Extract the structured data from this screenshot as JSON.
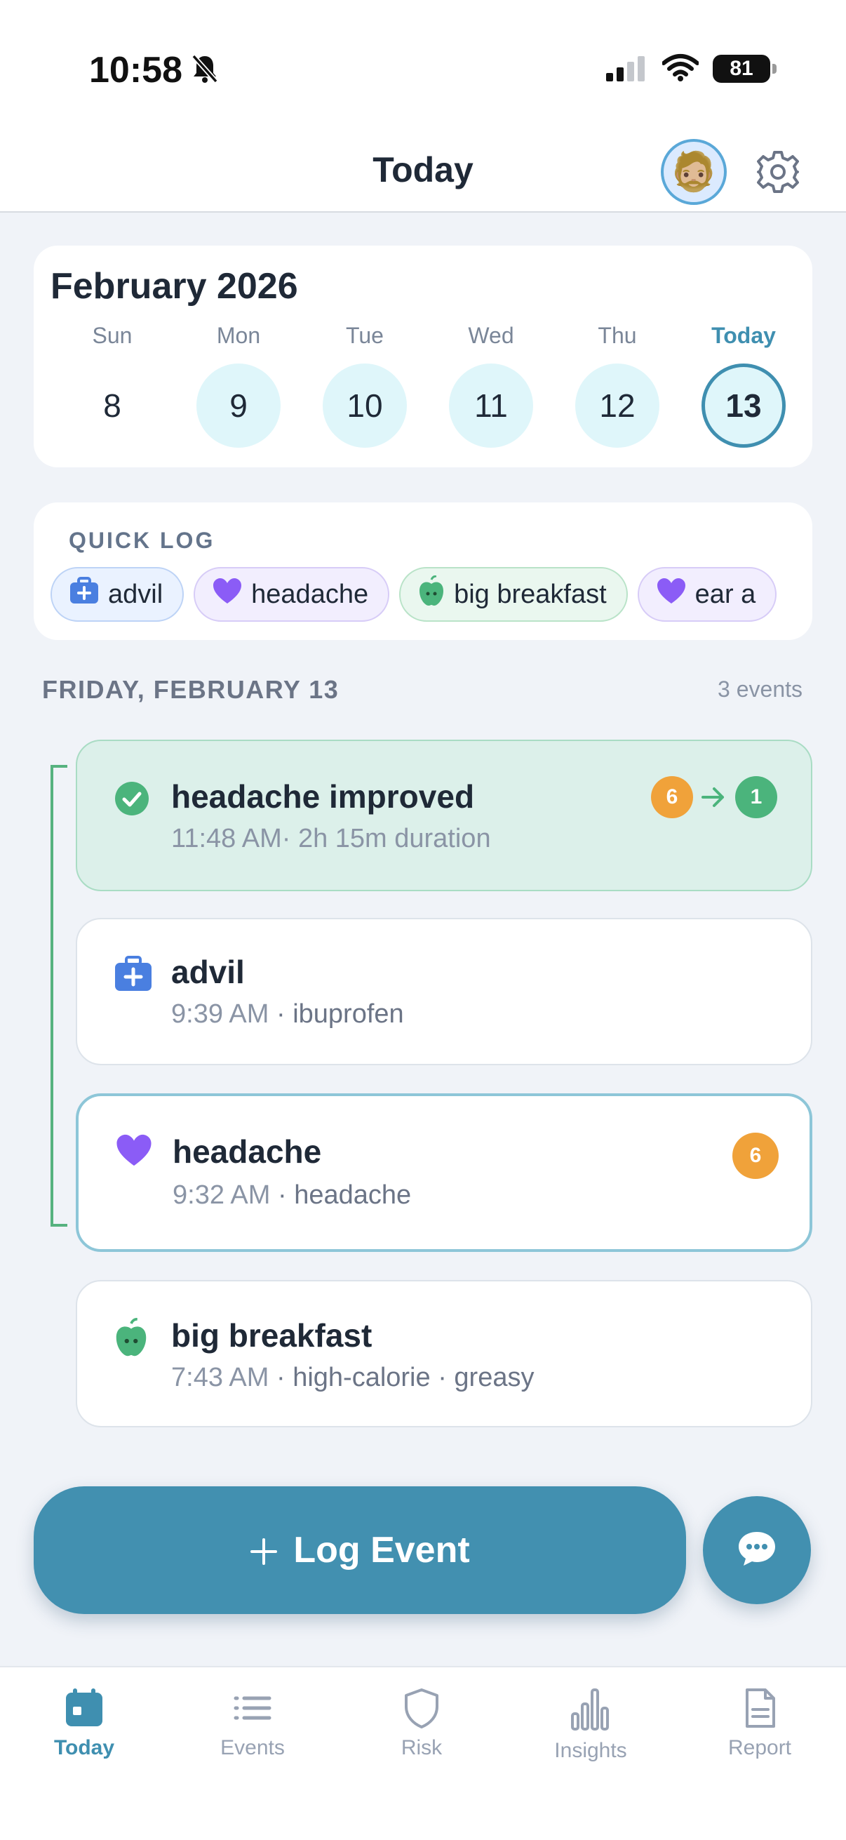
{
  "status_bar": {
    "time": "10:58",
    "battery": "81"
  },
  "header": {
    "title": "Today",
    "avatar": "🧔🏼"
  },
  "calendar": {
    "month": "February 2026",
    "days": [
      {
        "name": "Sun",
        "num": "8"
      },
      {
        "name": "Mon",
        "num": "9"
      },
      {
        "name": "Tue",
        "num": "10"
      },
      {
        "name": "Wed",
        "num": "11"
      },
      {
        "name": "Thu",
        "num": "12"
      },
      {
        "name": "Today",
        "num": "13"
      }
    ]
  },
  "quick_log": {
    "label": "QUICK LOG",
    "chips": [
      {
        "label": "advil",
        "icon": "medicine-kit-icon"
      },
      {
        "label": "headache",
        "icon": "heart-icon"
      },
      {
        "label": "big breakfast",
        "icon": "apple-icon"
      },
      {
        "label": "ear a",
        "icon": "heart-icon"
      }
    ]
  },
  "day": {
    "title": "FRIDAY, FEBRUARY 13",
    "count": "3 events"
  },
  "events": [
    {
      "title": "headache improved",
      "sub": "11:48 AM· 2h 15m duration",
      "from": "6",
      "to": "1"
    },
    {
      "title": "advil",
      "time": "9:39 AM",
      "detail": " · ibuprofen"
    },
    {
      "title": "headache",
      "time": "9:32 AM",
      "detail": " · headache",
      "severity": "6"
    },
    {
      "title": "big breakfast",
      "time": "7:43 AM",
      "detail": " · high-calorie · greasy"
    }
  ],
  "actions": {
    "log_event": "Log Event"
  },
  "tabs": [
    {
      "label": "Today"
    },
    {
      "label": "Events"
    },
    {
      "label": "Risk"
    },
    {
      "label": "Insights"
    },
    {
      "label": "Report"
    }
  ],
  "colors": {
    "accent": "#4290b0",
    "severity_high": "#f0a23a",
    "severity_low": "#4bb47c",
    "symptom": "#8b5cf6",
    "medication": "#4a7fe0",
    "food": "#4bb47c"
  }
}
